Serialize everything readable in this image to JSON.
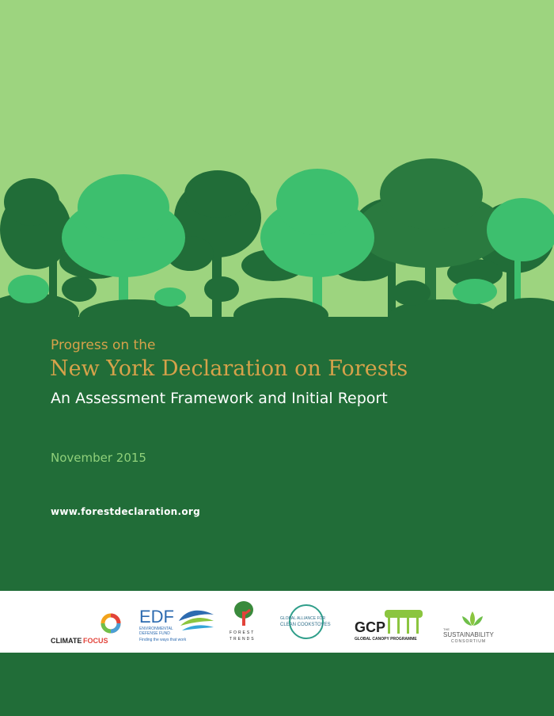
{
  "cover": {
    "pretitle": "Progress on the",
    "title": "New York Declaration on Forests",
    "subtitle": "An Assessment Framework and Initial Report",
    "date": "November 2015",
    "url": "www.forestdeclaration.org"
  },
  "colors": {
    "sky": "#9dd47f",
    "dark_green": "#216d38",
    "mid_green": "#3dbf6e",
    "gold": "#d6a24a",
    "light_green_text": "#8fd07a"
  },
  "logos": {
    "climate_focus": {
      "part1": "CLIMATE",
      "part2": "FOCUS"
    },
    "edf": {
      "name": "EDF",
      "line1": "ENVIRONMENTAL",
      "line2": "DEFENSE FUND",
      "tagline": "Finding the ways that work"
    },
    "forest_trends": {
      "line1": "FOREST",
      "line2": "TRENDS"
    },
    "cookstoves": {
      "line1": "GLOBAL ALLIANCE FOR",
      "line2": "CLEAN COOKSTOVES"
    },
    "gcp": {
      "name": "GCP",
      "full": "GLOBAL CANOPY PROGRAMME"
    },
    "sustainability": {
      "small": "THE",
      "name": "SUSTAINABILITY",
      "line2": "CONSORTIUM"
    }
  }
}
